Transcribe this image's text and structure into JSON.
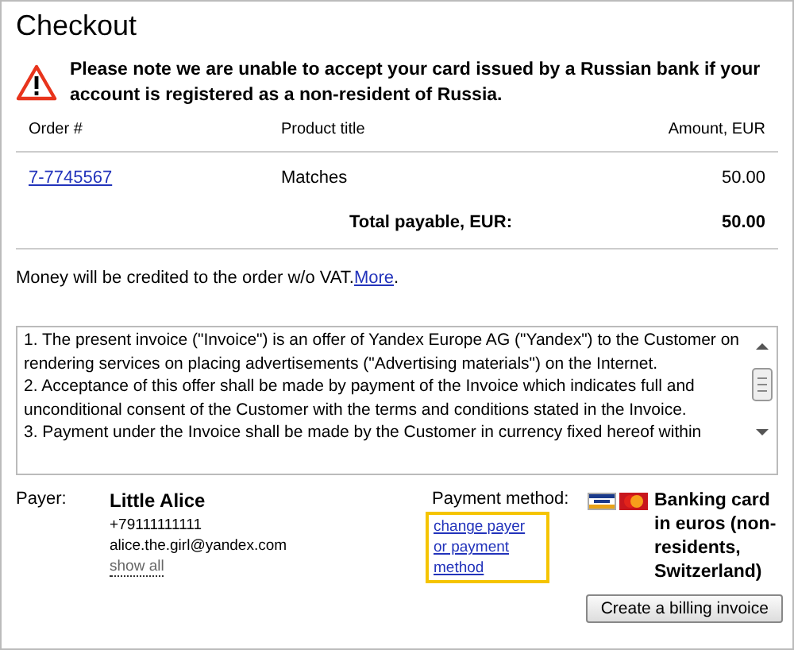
{
  "title": "Checkout",
  "warning": "Please note we are unable to accept your card issued by a Russian bank if your account is registered as a non-resident of Russia.",
  "table": {
    "columns": [
      "Order #",
      "Product title",
      "Amount, EUR"
    ],
    "rows": [
      {
        "order": "7-7745567",
        "product": "Matches",
        "amount": "50.00"
      }
    ],
    "total_label": "Total payable, EUR:",
    "total": "50.00"
  },
  "vat_note": {
    "text": "Money will be credited to the order w/o VAT.",
    "link": "More",
    "after": "."
  },
  "terms": [
    "1.  The present invoice (\"Invoice\") is an offer of Yandex Europe AG (\"Yandex\") to the Customer on rendering services on placing advertisements (\"Advertising materials\") on the Internet.",
    "2.  Acceptance of this offer shall be made by payment of the Invoice which indicates full and unconditional consent of the Customer with the terms and conditions stated in the Invoice.",
    "3.  Payment under the Invoice shall be made by the Customer in currency fixed hereof within"
  ],
  "payer": {
    "label": "Payer:",
    "name": "Little Alice",
    "phone": "+79111111111",
    "email": "alice.the.girl@yandex.com",
    "show_all": "show all"
  },
  "payment": {
    "label": "Payment method:",
    "change_link": "change payer or payment method",
    "highlighted": true,
    "method": "Banking card in euros (non-residents, Switzerland)"
  },
  "button": "Create a billing invoice"
}
